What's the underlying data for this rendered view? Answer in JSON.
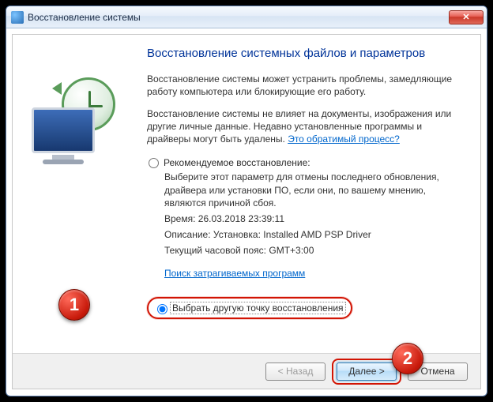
{
  "window": {
    "title": "Восстановление системы"
  },
  "heading": "Восстановление системных файлов и параметров",
  "para1": "Восстановление системы может устранить проблемы, замедляющие работу компьютера или блокирующие его работу.",
  "para2": "Восстановление системы не влияет на документы, изображения или другие личные данные. Недавно установленные программы и драйверы могут быть удалены. ",
  "link_reversible": "Это обратимый процесс?",
  "option_recommended": {
    "label": "Рекомендуемое восстановление:",
    "desc": "Выберите этот параметр для отмены последнего обновления, драйвера или установки ПО, если они, по вашему мнению, являются причиной сбоя.",
    "time_label": "Время:",
    "time_value": "26.03.2018 23:39:11",
    "desc_label": "Описание:",
    "desc_value": "Установка: Installed AMD PSP Driver",
    "tz_label": "Текущий часовой пояс:",
    "tz_value": "GMT+3:00"
  },
  "link_affected": "Поиск затрагиваемых программ",
  "option_other": {
    "label": "Выбрать другую точку восстановления"
  },
  "buttons": {
    "back": "< Назад",
    "next": "Далее >",
    "cancel": "Отмена"
  },
  "annotations": {
    "badge1": "1",
    "badge2": "2"
  }
}
